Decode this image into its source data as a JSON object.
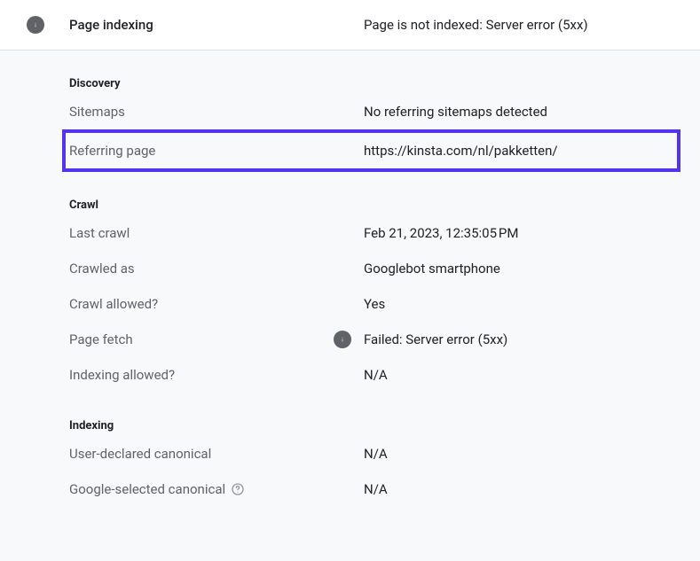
{
  "header": {
    "title": "Page indexing",
    "status": "Page is not indexed: Server error (5xx)"
  },
  "sections": {
    "discovery": {
      "heading": "Discovery",
      "sitemaps_label": "Sitemaps",
      "sitemaps_value": "No referring sitemaps detected",
      "referring_label": "Referring page",
      "referring_value": "https://kinsta.com/nl/pakketten/"
    },
    "crawl": {
      "heading": "Crawl",
      "last_crawl_label": "Last crawl",
      "last_crawl_value": "Feb 21, 2023, 12:35:05 PM",
      "crawled_as_label": "Crawled as",
      "crawled_as_value": "Googlebot smartphone",
      "crawl_allowed_label": "Crawl allowed?",
      "crawl_allowed_value": "Yes",
      "page_fetch_label": "Page fetch",
      "page_fetch_value": "Failed: Server error (5xx)",
      "indexing_allowed_label": "Indexing allowed?",
      "indexing_allowed_value": "N/A"
    },
    "indexing": {
      "heading": "Indexing",
      "user_canonical_label": "User-declared canonical",
      "user_canonical_value": "N/A",
      "google_canonical_label": "Google-selected canonical",
      "google_canonical_value": "N/A"
    }
  }
}
